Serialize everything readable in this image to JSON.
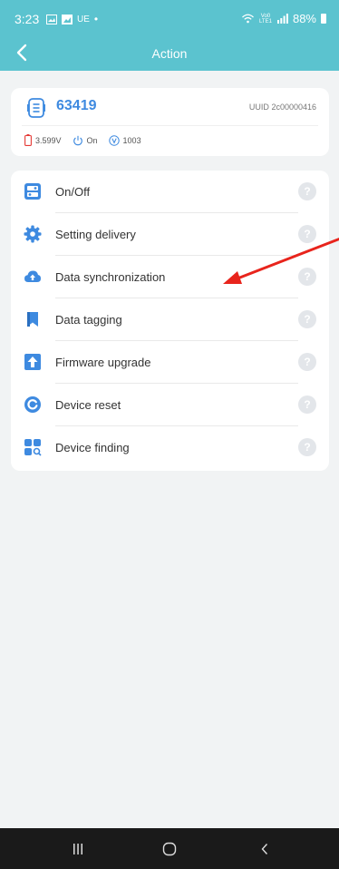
{
  "status_bar": {
    "time": "3:23",
    "carrier_badge": "UE",
    "dot": "•",
    "network": "Vo0 LTE1",
    "battery_pct": "88%"
  },
  "header": {
    "title": "Action"
  },
  "device": {
    "name": "63419",
    "uuid_label": "UUID",
    "uuid": "2c00000416",
    "voltage": "3.599V",
    "power": "On",
    "version": "1003"
  },
  "menu": {
    "help_glyph": "?",
    "items": [
      {
        "label": "On/Off",
        "icon": "toggle-icon"
      },
      {
        "label": "Setting delivery",
        "icon": "gear-icon"
      },
      {
        "label": "Data synchronization",
        "icon": "cloud-upload-icon"
      },
      {
        "label": "Data tagging",
        "icon": "bookmark-icon"
      },
      {
        "label": "Firmware upgrade",
        "icon": "upload-arrow-icon"
      },
      {
        "label": "Device reset",
        "icon": "reset-icon"
      },
      {
        "label": "Device finding",
        "icon": "device-search-icon"
      }
    ]
  },
  "colors": {
    "header": "#5bc3cf",
    "accent_blue": "#3e8ae0",
    "annotation_arrow": "#e8241c",
    "battery_icon": "#e53935"
  }
}
